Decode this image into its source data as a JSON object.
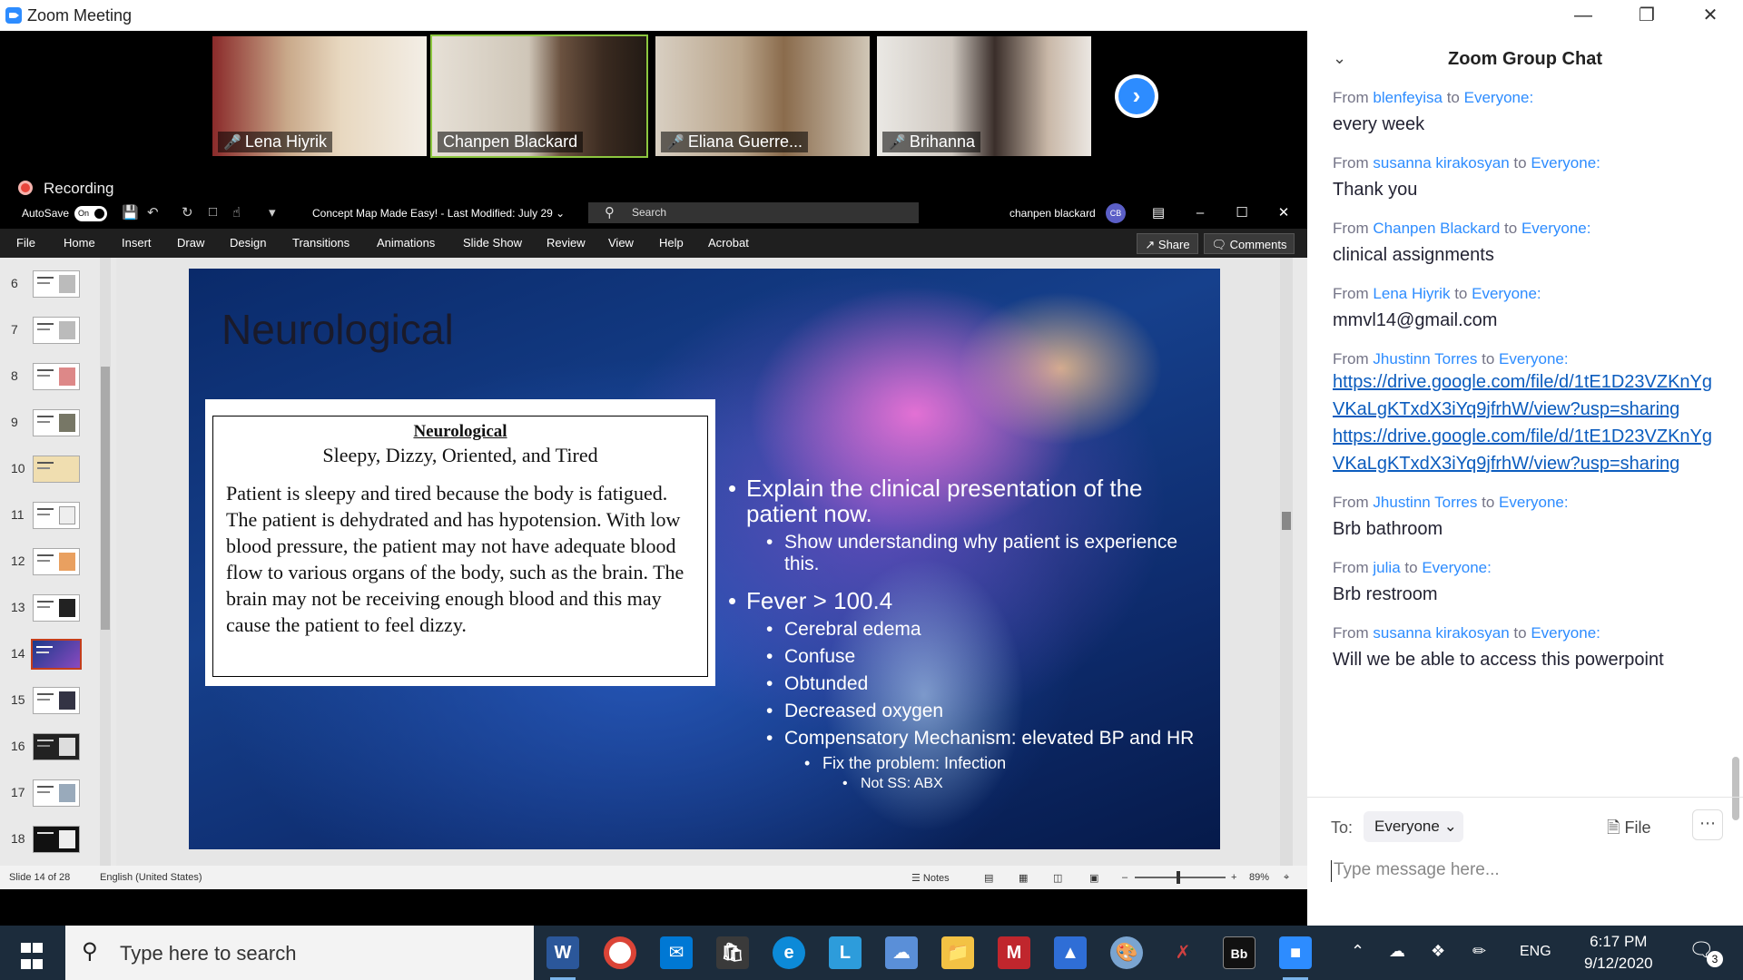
{
  "window": {
    "title": "Zoom Meeting"
  },
  "participants": [
    {
      "name": "Lena Hiyrik",
      "muted": true
    },
    {
      "name": "Chanpen Blackard",
      "muted": false,
      "active": true
    },
    {
      "name": "Eliana Guerre...",
      "muted": true
    },
    {
      "name": "Brihanna",
      "muted": true
    }
  ],
  "recording_label": "Recording",
  "ppt": {
    "autosave_label": "AutoSave",
    "autosave_state": "On",
    "doc_title": "Concept Map Made Easy!  -  Last Modified: July 29  ⌄",
    "search_placeholder": "Search",
    "user_name": "chanpen blackard",
    "user_initials": "CB",
    "tabs": [
      "File",
      "Home",
      "Insert",
      "Draw",
      "Design",
      "Transitions",
      "Animations",
      "Slide Show",
      "Review",
      "View",
      "Help",
      "Acrobat"
    ],
    "share_label": "Share",
    "comments_label": "Comments",
    "slide_numbers": [
      "6",
      "7",
      "8",
      "9",
      "10",
      "11",
      "12",
      "13",
      "14",
      "15",
      "16",
      "17",
      "18"
    ],
    "selected_slide": "14",
    "status": {
      "slide_info": "Slide 14 of 28",
      "language": "English (United States)",
      "notes_label": "Notes",
      "zoom": "89%"
    }
  },
  "slide": {
    "title": "Neurological",
    "box_heading": "Neurological",
    "box_subheading": "Sleepy, Dizzy, Oriented, and Tired",
    "box_body": "Patient is sleepy and tired because the body is fatigued.  The patient is dehydrated and has hypotension.  With low blood pressure, the patient may not have adequate blood flow to various organs of the body, such as the brain.  The brain may not be receiving enough blood and this may cause the patient to feel dizzy.",
    "bullets": [
      {
        "level": 1,
        "text": "Explain the clinical presentation of the patient now."
      },
      {
        "level": 2,
        "text": "Show understanding why patient is experience this."
      },
      {
        "level": 1,
        "text": "Fever > 100.4"
      },
      {
        "level": 2,
        "text": "Cerebral edema"
      },
      {
        "level": 2,
        "text": "Confuse"
      },
      {
        "level": 2,
        "text": "Obtunded"
      },
      {
        "level": 2,
        "text": "Decreased oxygen"
      },
      {
        "level": 2,
        "text": "Compensatory Mechanism: elevated BP and HR"
      },
      {
        "level": 3,
        "text": "Fix the problem: Infection"
      },
      {
        "level": 4,
        "text": "Not SS: ABX"
      }
    ]
  },
  "chat": {
    "title": "Zoom Group Chat",
    "messages": [
      {
        "from": "blenfeyisa",
        "to": "Everyone:",
        "text": "every week"
      },
      {
        "from": "susanna kirakosyan",
        "to": "Everyone:",
        "text": "Thank you"
      },
      {
        "from": "Chanpen Blackard",
        "to": "Everyone:",
        "text": "clinical assignments"
      },
      {
        "from": "Lena Hiyrik",
        "to": "Everyone:",
        "text": "mmvl14@gmail.com"
      },
      {
        "from": "Jhustinn Torres",
        "to": "Everyone:",
        "links": [
          "https://drive.google.com/file/d/1tE1D23VZKnYgVKaLgKTxdX3iYq9jfrhW/view?usp=sharing",
          "https://drive.google.com/file/d/1tE1D23VZKnYgVKaLgKTxdX3iYq9jfrhW/view?usp=sharing"
        ]
      },
      {
        "from": "Jhustinn Torres",
        "to": "Everyone:",
        "text": "Brb bathroom"
      },
      {
        "from": "julia",
        "to": "Everyone:",
        "text": "Brb restroom"
      },
      {
        "from": "susanna kirakosyan",
        "to": "Everyone:",
        "text": "Will we be able to access this powerpoint"
      }
    ],
    "from_word": "From",
    "to_word": "to",
    "to_label": "To:",
    "recipient": "Everyone",
    "file_label": "File",
    "input_placeholder": "Type message here..."
  },
  "taskbar": {
    "search_placeholder": "Type here to search",
    "language": "ENG",
    "time": "6:17 PM",
    "date": "9/12/2020",
    "notification_count": "3"
  },
  "icons": [
    "zoom-logo-icon",
    "minimize-icon",
    "restore-icon",
    "close-icon",
    "mic-muted-icon",
    "next-arrow-icon",
    "record-dot-icon",
    "search-icon",
    "start-icon",
    "chevron-down-icon",
    "file-icon",
    "more-icon"
  ],
  "colors": {
    "zoom_blue": "#2d8cff",
    "active_speaker": "#8cc63f",
    "recording_red": "#e8453c",
    "chat_name": "#2d8cff",
    "link": "#0b5cbe",
    "taskbar": "#1c2c3c"
  }
}
